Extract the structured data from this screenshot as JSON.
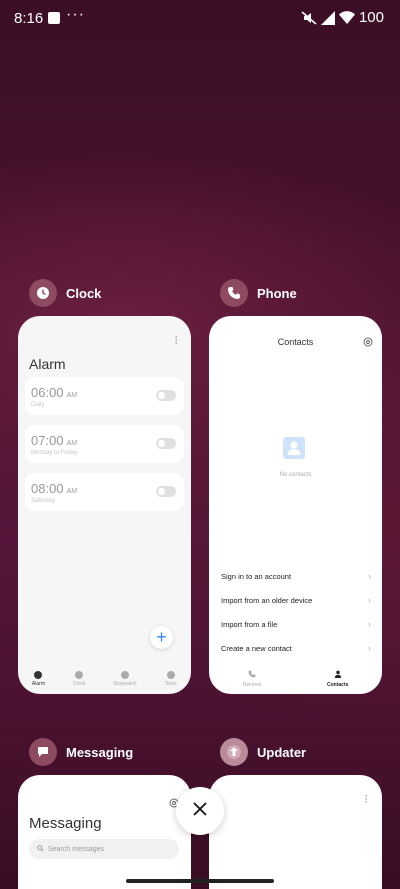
{
  "status_bar": {
    "time": "8:16",
    "overflow": "···",
    "battery": "100",
    "icons": [
      "mute-icon",
      "signal-icon",
      "wifi-icon"
    ]
  },
  "clock_app": {
    "name": "Clock",
    "icon": "clock-icon",
    "screen_title": "Alarm",
    "alarms": [
      {
        "time": "06:00",
        "ampm": "AM",
        "label": "Daily"
      },
      {
        "time": "07:00",
        "ampm": "AM",
        "label": "Monday to Friday"
      },
      {
        "time": "08:00",
        "ampm": "AM",
        "label": "Saturday"
      }
    ],
    "fab": "+",
    "nav": [
      "Alarm",
      "Clock",
      "Stopwatch",
      "Timer"
    ]
  },
  "phone_app": {
    "name": "Phone",
    "icon": "phone-icon",
    "screen_title": "Contacts",
    "empty_text": "No contacts",
    "options": [
      "Sign in to an account",
      "Import from an older device",
      "Import from a file",
      "Create a new contact"
    ],
    "nav": [
      "Recents",
      "Contacts"
    ]
  },
  "messaging_app": {
    "name": "Messaging",
    "icon": "chat-icon",
    "screen_title": "Messaging",
    "search_placeholder": "Search messages"
  },
  "updater_app": {
    "name": "Updater",
    "icon": "update-arrow-icon"
  },
  "close_label": "×",
  "colors": {
    "accent_blue": "#3b82f6",
    "app_icon_bg": "#8e4a61"
  }
}
